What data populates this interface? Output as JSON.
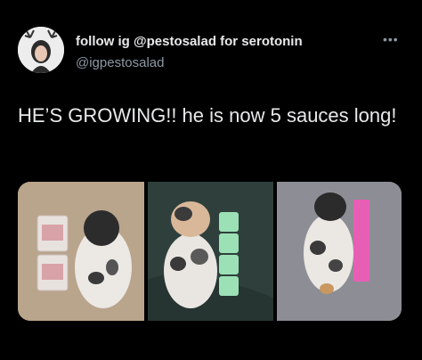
{
  "tweet": {
    "display_name": "follow ig @pestosalad for serotonin",
    "handle": "@igpestosalad",
    "more_icon": "more-horizontal-icon",
    "text": "HE’S GROWING!! he is now 5 sauces long!"
  },
  "media": [
    {
      "photo": "kitten next to 2 sauce packets on tan rug"
    },
    {
      "photo": "kitten next to green sauce packets on dark blanket"
    },
    {
      "photo": "kitten next to pink sauce packets on gray floor"
    }
  ]
}
